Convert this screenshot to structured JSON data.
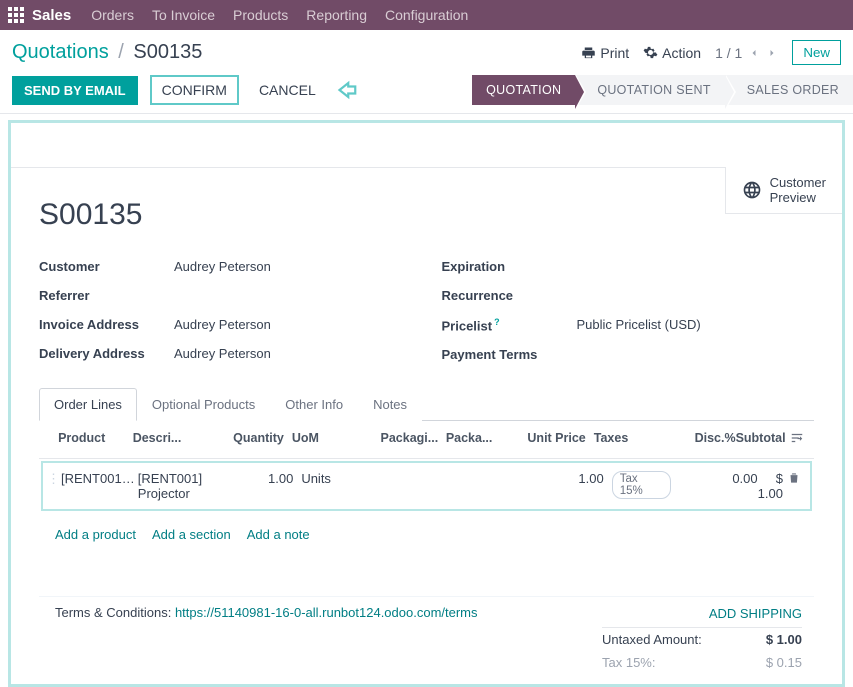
{
  "topbar": {
    "app_title": "Sales",
    "menu": [
      "Orders",
      "To Invoice",
      "Products",
      "Reporting",
      "Configuration"
    ]
  },
  "breadcrumb": {
    "root": "Quotations",
    "current": "S00135"
  },
  "header": {
    "print": "Print",
    "action": "Action",
    "pager": "1 / 1",
    "new": "New"
  },
  "actions": {
    "send": "SEND BY EMAIL",
    "confirm": "CONFIRM",
    "cancel": "CANCEL"
  },
  "status": {
    "quotation": "QUOTATION",
    "sent": "QUOTATION SENT",
    "sales_order": "SALES ORDER"
  },
  "preview": {
    "line1": "Customer",
    "line2": "Preview"
  },
  "order": {
    "title": "S00135"
  },
  "fields": {
    "customer_label": "Customer",
    "customer_value": "Audrey Peterson",
    "referrer_label": "Referrer",
    "referrer_value": "",
    "invoice_addr_label": "Invoice Address",
    "invoice_addr_value": "Audrey Peterson",
    "delivery_addr_label": "Delivery Address",
    "delivery_addr_value": "Audrey Peterson",
    "expiration_label": "Expiration",
    "expiration_value": "",
    "recurrence_label": "Recurrence",
    "recurrence_value": "",
    "pricelist_label": "Pricelist",
    "pricelist_value": "Public Pricelist (USD)",
    "payment_terms_label": "Payment Terms",
    "payment_terms_value": ""
  },
  "tabs": {
    "order_lines": "Order Lines",
    "optional": "Optional Products",
    "other": "Other Info",
    "notes": "Notes"
  },
  "cols": {
    "product": "Product",
    "description": "Descri...",
    "quantity": "Quantity",
    "uom": "UoM",
    "packaging_i": "Packagi...",
    "packaging_a": "Packa...",
    "unit_price": "Unit Price",
    "taxes": "Taxes",
    "disc": "Disc.%",
    "subtotal": "Subtotal"
  },
  "line": {
    "product": "[RENT001] ...",
    "desc1": "[RENT001]",
    "desc2": "Projector",
    "qty": "1.00",
    "uom": "Units",
    "price": "1.00",
    "tax": "Tax 15%",
    "disc": "0.00",
    "subtotal": "$ 1.00"
  },
  "add": {
    "product": "Add a product",
    "section": "Add a section",
    "note": "Add a note"
  },
  "add_shipping": "ADD SHIPPING",
  "totals": {
    "untaxed_label": "Untaxed Amount:",
    "untaxed": "$ 1.00",
    "tax_label": "Tax 15%:",
    "tax": "$ 0.15"
  },
  "terms": {
    "label": "Terms & Conditions:",
    "link": "https://51140981-16-0-all.runbot124.odoo.com/terms"
  },
  "chart_data": {
    "type": "table",
    "columns": [
      "Product",
      "Description",
      "Quantity",
      "UoM",
      "Packaging",
      "Packaging Qty",
      "Unit Price",
      "Taxes",
      "Disc.%",
      "Subtotal"
    ],
    "rows": [
      [
        "[RENT001]",
        "[RENT001] Projector",
        1.0,
        "Units",
        "",
        "",
        1.0,
        "Tax 15%",
        0.0,
        1.0
      ]
    ],
    "untaxed_amount": 1.0,
    "tax_15_pct": 0.15
  }
}
